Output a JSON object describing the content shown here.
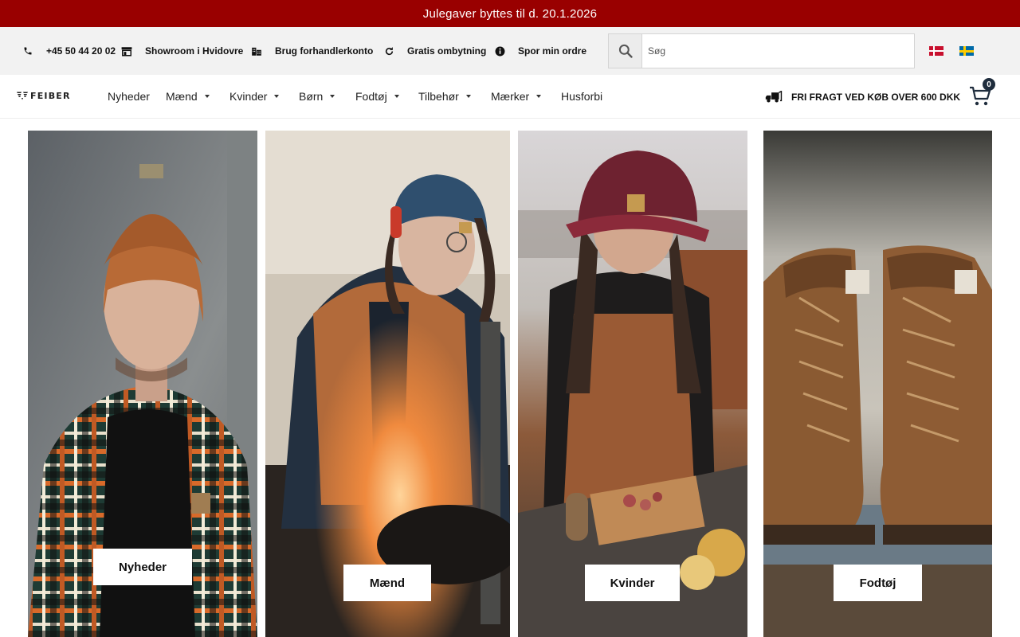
{
  "announcement": {
    "text": "Julegaver byttes til d. 20.1.2026"
  },
  "utility_bar": {
    "phone": "+45 50 44 20 02",
    "showroom": "Showroom i Hvidovre",
    "dealer": "Brug forhandlerkonto",
    "exchange": "Gratis ombytning",
    "track": "Spor min ordre"
  },
  "search": {
    "placeholder": "Søg"
  },
  "languages": [
    "Danish",
    "Swedish"
  ],
  "logo": {
    "text": "FEIBER"
  },
  "nav": {
    "items": [
      {
        "label": "Nyheder",
        "dropdown": false
      },
      {
        "label": "Mænd",
        "dropdown": true
      },
      {
        "label": "Kvinder",
        "dropdown": true
      },
      {
        "label": "Børn",
        "dropdown": true
      },
      {
        "label": "Fodtøj",
        "dropdown": true
      },
      {
        "label": "Tilbehør",
        "dropdown": true
      },
      {
        "label": "Mærker",
        "dropdown": true
      },
      {
        "label": "Husforbi",
        "dropdown": false
      }
    ]
  },
  "shipping": {
    "text": "FRI FRAGT VED KØB OVER 600 DKK"
  },
  "cart": {
    "count": "0"
  },
  "categories": [
    {
      "label": "Nyheder",
      "image": "man-in-orange-beanie-and-flannel-shirt"
    },
    {
      "label": "Mænd",
      "image": "man-in-blue-beanie-grinding-metal"
    },
    {
      "label": "Kvinder",
      "image": "woman-in-cap-cutting-food-on-board"
    },
    {
      "label": "Fodtøj",
      "image": "pair-of-brown-work-boots"
    }
  ],
  "colors": {
    "announcement_bg": "#990000",
    "utility_bg": "#f2f2f2",
    "cart_badge": "#1f2d3d"
  }
}
